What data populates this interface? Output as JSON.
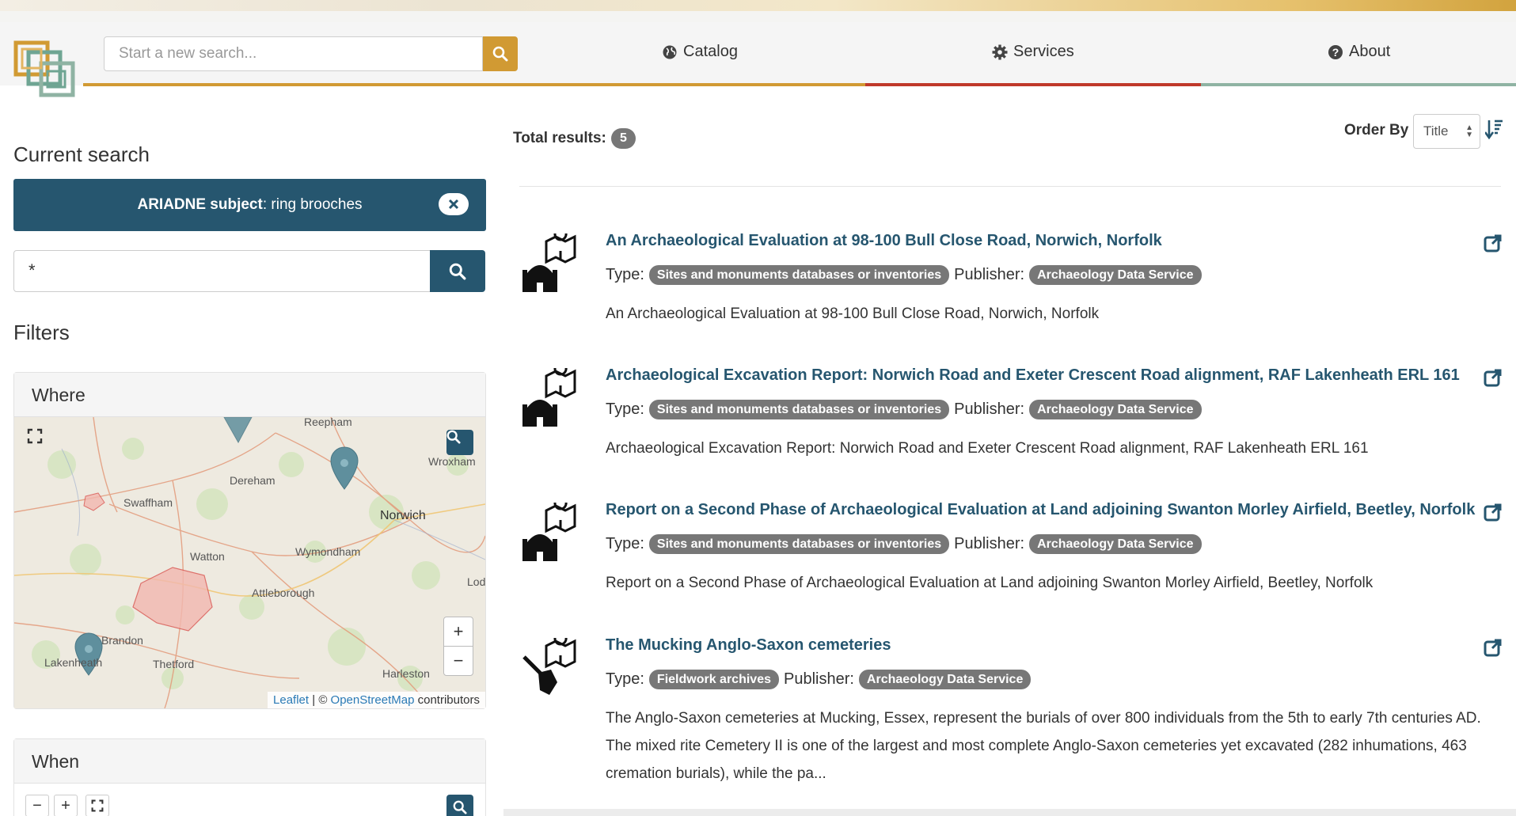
{
  "header": {
    "search_placeholder": "Start a new search...",
    "nav": [
      {
        "label": "Catalog",
        "icon": "globe-icon"
      },
      {
        "label": "Services",
        "icon": "gear-icon"
      },
      {
        "label": "About",
        "icon": "question-circle-icon"
      }
    ],
    "accent_colors": [
      "#d19a33",
      "#c0392b",
      "#8fb3a3"
    ]
  },
  "sidebar": {
    "current_search_heading": "Current search",
    "active_filter": {
      "field": "ARIADNE subject",
      "value": "ring brooches"
    },
    "query_value": "*",
    "filters_heading": "Filters",
    "where": {
      "heading": "Where",
      "places": [
        "Reepham",
        "Wroxham",
        "Dereham",
        "Swaffham",
        "Norwich",
        "Watton",
        "Wymondham",
        "Attleborough",
        "Brandon",
        "Thetford",
        "Harleston",
        "Lakenheath",
        "Loddon"
      ],
      "attribution": {
        "leaflet": "Leaflet",
        "sep": "| ©",
        "osm": "OpenStreetMap",
        "suffix": "contributors"
      },
      "zoom_in": "+",
      "zoom_out": "−"
    },
    "when": {
      "heading": "When",
      "zoom_out": "−",
      "zoom_in": "+"
    }
  },
  "results": {
    "total_label": "Total results:",
    "total": "5",
    "order_by_label": "Order By",
    "order_by_value": "Title",
    "type_label": "Type:",
    "publisher_label": "Publisher:",
    "items": [
      {
        "title": "An Archaeological Evaluation at 98-100 Bull Close Road, Norwich, Norfolk",
        "type": "Sites and monuments databases or inventories",
        "publisher": "Archaeology Data Service",
        "description": "An Archaeological Evaluation at 98-100 Bull Close Road, Norwich, Norfolk",
        "icon": "sites-monuments-icon"
      },
      {
        "title": "Archaeological Excavation Report: Norwich Road and Exeter Crescent Road alignment, RAF Lakenheath ERL 161",
        "type": "Sites and monuments databases or inventories",
        "publisher": "Archaeology Data Service",
        "description": "Archaeological Excavation Report: Norwich Road and Exeter Crescent Road alignment, RAF Lakenheath ERL 161",
        "icon": "sites-monuments-icon"
      },
      {
        "title": "Report on a Second Phase of Archaeological Evaluation at Land adjoining Swanton Morley Airfield, Beetley, Norfolk",
        "type": "Sites and monuments databases or inventories",
        "publisher": "Archaeology Data Service",
        "description": "Report on a Second Phase of Archaeological Evaluation at Land adjoining Swanton Morley Airfield, Beetley, Norfolk",
        "icon": "sites-monuments-icon"
      },
      {
        "title": "The Mucking Anglo-Saxon cemeteries",
        "type": "Fieldwork archives",
        "publisher": "Archaeology Data Service",
        "description": "The Anglo-Saxon cemeteries at Mucking, Essex, represent the burials of over 800 individuals from the 5th to early 7th centuries AD. The mixed rite Cemetery II is one of the largest and most complete Anglo-Saxon cemeteries yet excavated (282 inhumations, 463 cremation burials), while the pa...",
        "icon": "fieldwork-shovel-icon"
      }
    ]
  }
}
